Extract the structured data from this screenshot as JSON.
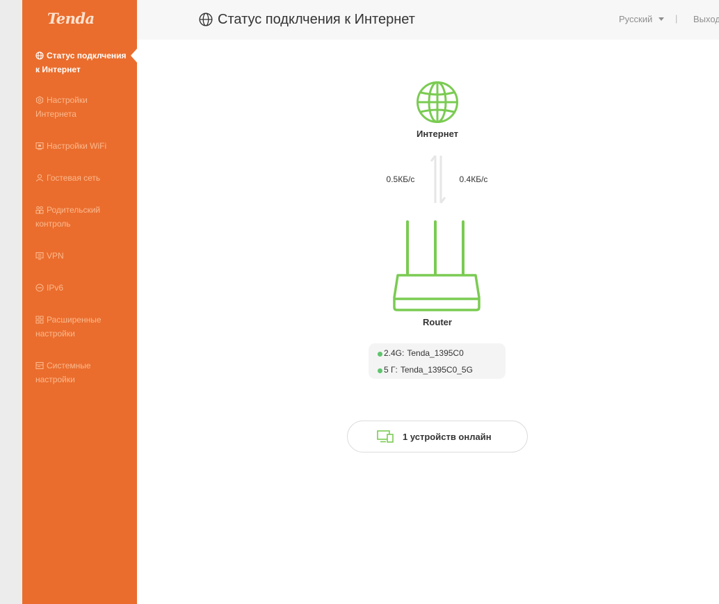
{
  "brand": {
    "logo_text": "Tenda"
  },
  "colors": {
    "sidebar": "#ea6d2d",
    "accent_green": "#7acb52",
    "status_dot": "#5ec46c"
  },
  "sidebar": {
    "items": [
      {
        "icon": "globe-icon",
        "line1": "Статус подклчения",
        "line2": "к Интернет",
        "active": true
      },
      {
        "icon": "gear-hex-icon",
        "line1": "Настройки",
        "line2": "Интернета",
        "active": false
      },
      {
        "icon": "wifi-screen-icon",
        "line1": "Настройки WiFi",
        "line2": "",
        "active": false
      },
      {
        "icon": "guest-user-icon",
        "line1": "Гостевая сеть",
        "line2": "",
        "active": false
      },
      {
        "icon": "parental-users-icon",
        "line1": "Родительский",
        "line2": "контроль",
        "active": false
      },
      {
        "icon": "vpn-monitor-icon",
        "line1": "VPN",
        "line2": "",
        "active": false
      },
      {
        "icon": "ipv6-circle-icon",
        "line1": "IPv6",
        "line2": "",
        "active": false
      },
      {
        "icon": "grid-icon",
        "line1": "Расширенные",
        "line2": "настройки",
        "active": false
      },
      {
        "icon": "system-panel-icon",
        "line1": "Системные",
        "line2": "настройки",
        "active": false
      }
    ]
  },
  "header": {
    "title": "Статус подклчения к Интернет",
    "title_icon": "globe-icon",
    "language": "Русский",
    "separator": "|",
    "logout": "Выход"
  },
  "status": {
    "internet_label": "Интернет",
    "upload_rate": "0.5КБ/с",
    "download_rate": "0.4КБ/с",
    "router_label": "Router",
    "wifi": [
      {
        "band": "2.4G:",
        "ssid": "Tenda_1395C0"
      },
      {
        "band": "5 Г:",
        "ssid": "Tenda_1395C0_5G"
      }
    ],
    "devices_text": "1 устройств онлайн"
  }
}
